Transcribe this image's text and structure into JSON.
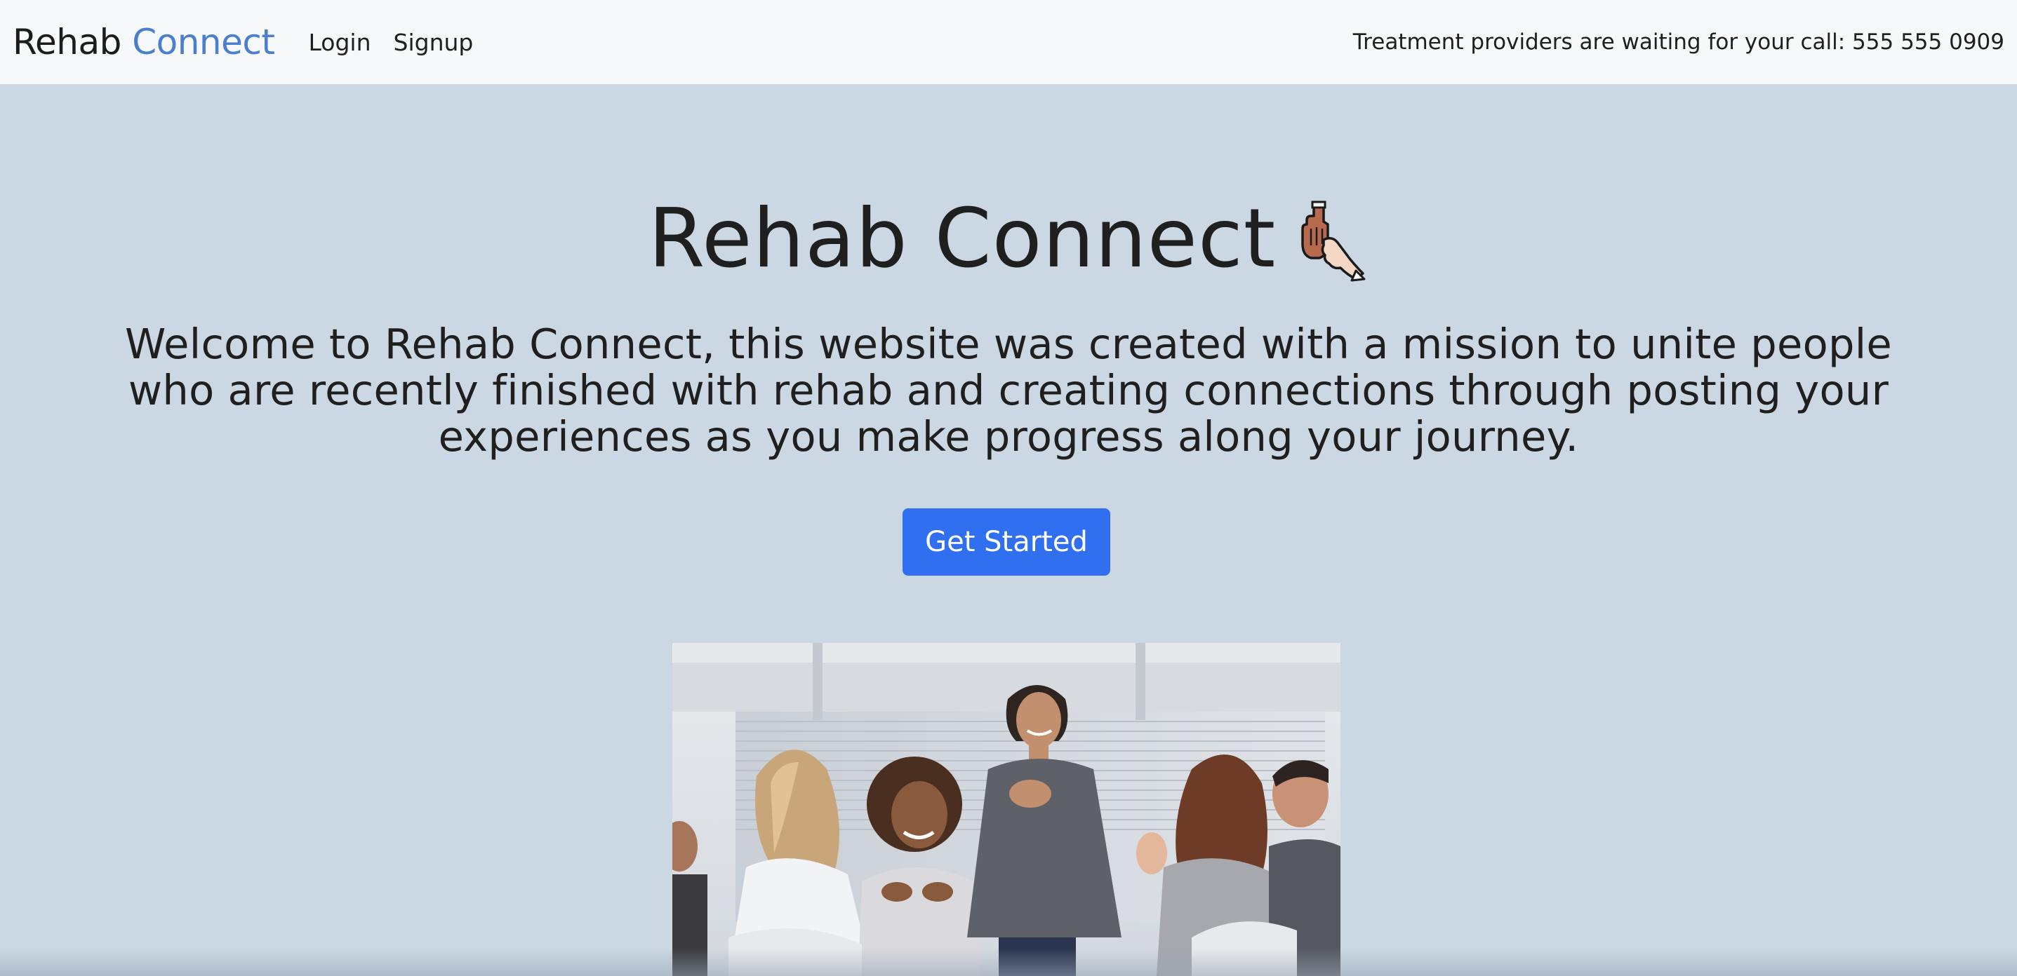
{
  "navbar": {
    "brand_part1": "Rehab",
    "brand_part2": "Connect",
    "links": [
      {
        "label": "Login"
      },
      {
        "label": "Signup"
      }
    ],
    "phone_text": "Treatment providers are waiting for your call: 555 555 0909"
  },
  "hero": {
    "title": "Rehab Connect",
    "icon": "helping-hands-icon",
    "description": "Welcome to Rehab Connect, this website was created with a mission to unite people who are recently finished with rehab and creating connections through posting your experiences as you make progress along your journey.",
    "cta_label": "Get Started"
  },
  "colors": {
    "navbar_bg": "#f7f8fa",
    "page_bg": "#cbd7e2",
    "brand_accent": "#4a7fd0",
    "button_bg": "#2f6ff0",
    "button_text": "#ffffff"
  }
}
